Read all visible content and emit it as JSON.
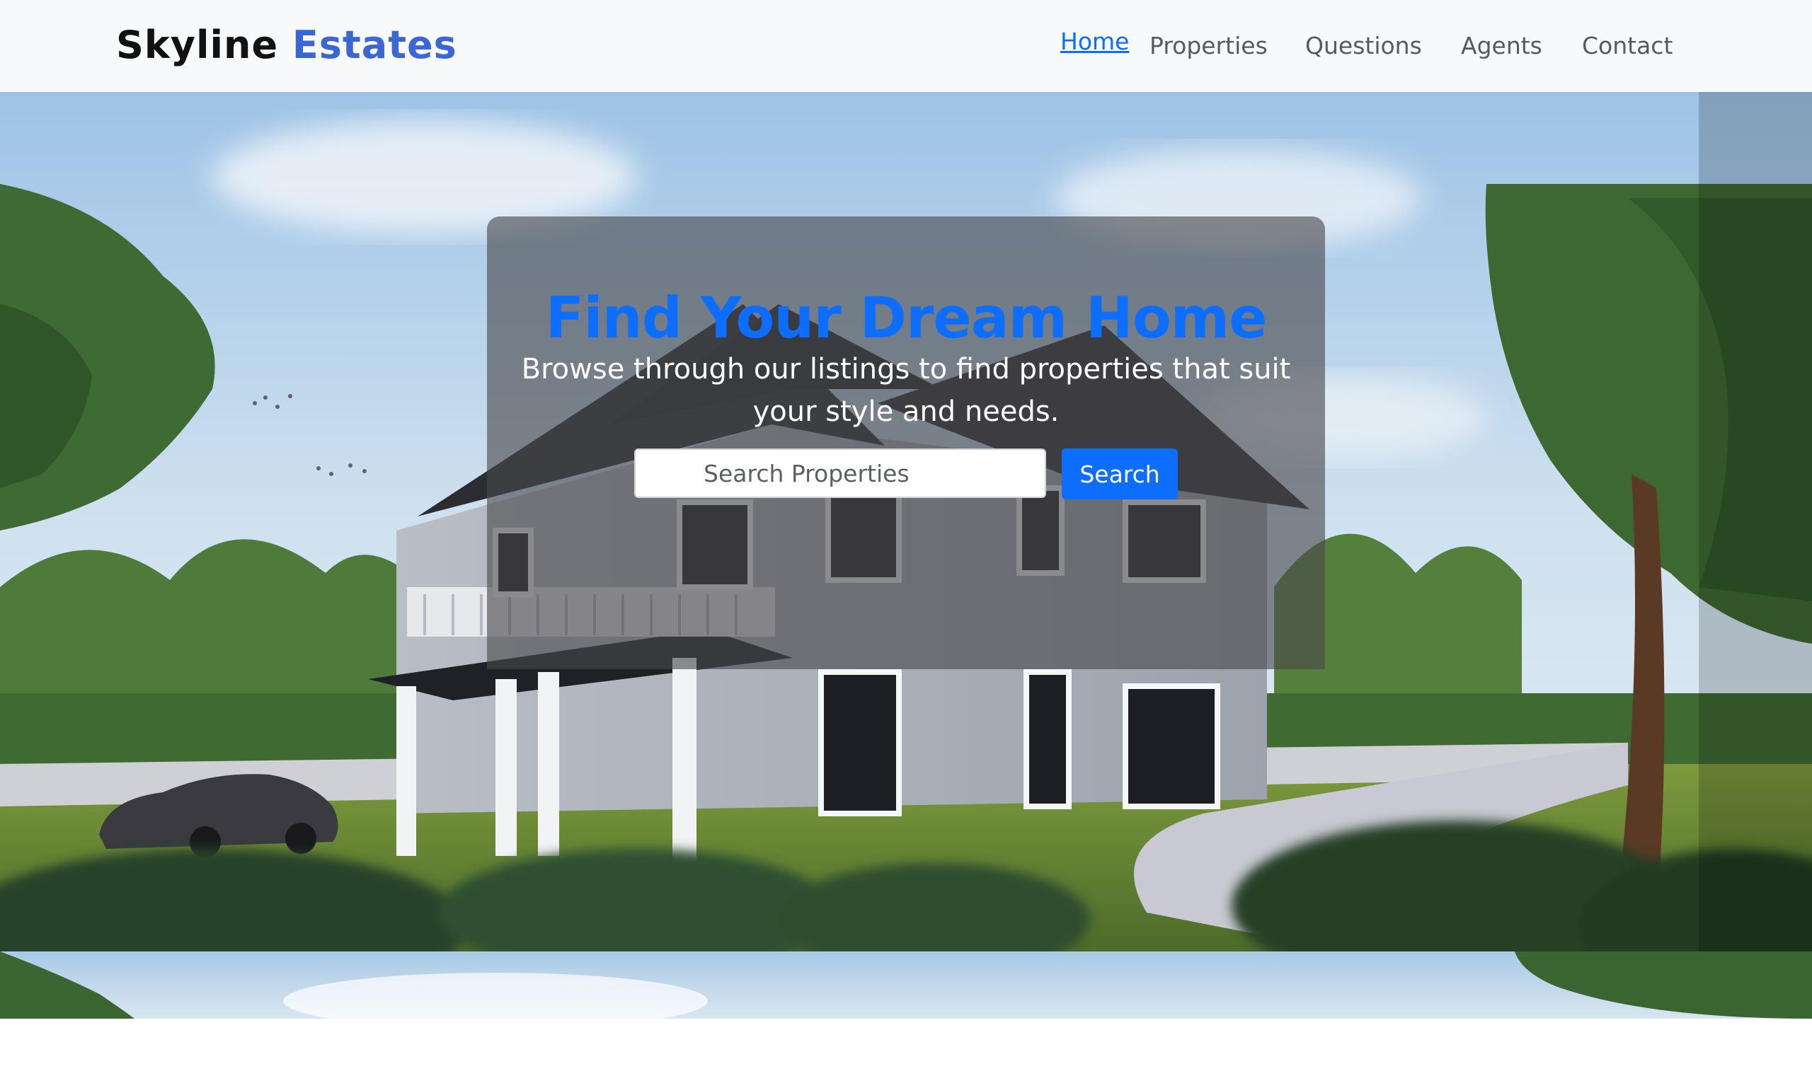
{
  "brand": {
    "part1": "Skyline",
    "part2": "Estates"
  },
  "nav": {
    "home": "Home",
    "properties": "Properties",
    "questions": "Questions",
    "agents": "Agents",
    "contact": "Contact"
  },
  "hero": {
    "title": "Find Your Dream Home",
    "subtitle": "Browse through our listings to find properties that suit your style and needs.",
    "search_placeholder": "Search Properties",
    "search_value": "",
    "search_button": "Search"
  },
  "colors": {
    "accent": "#0d6efd",
    "brand_accent": "#3a66d6",
    "navbar_bg": "#f8f9fa"
  }
}
